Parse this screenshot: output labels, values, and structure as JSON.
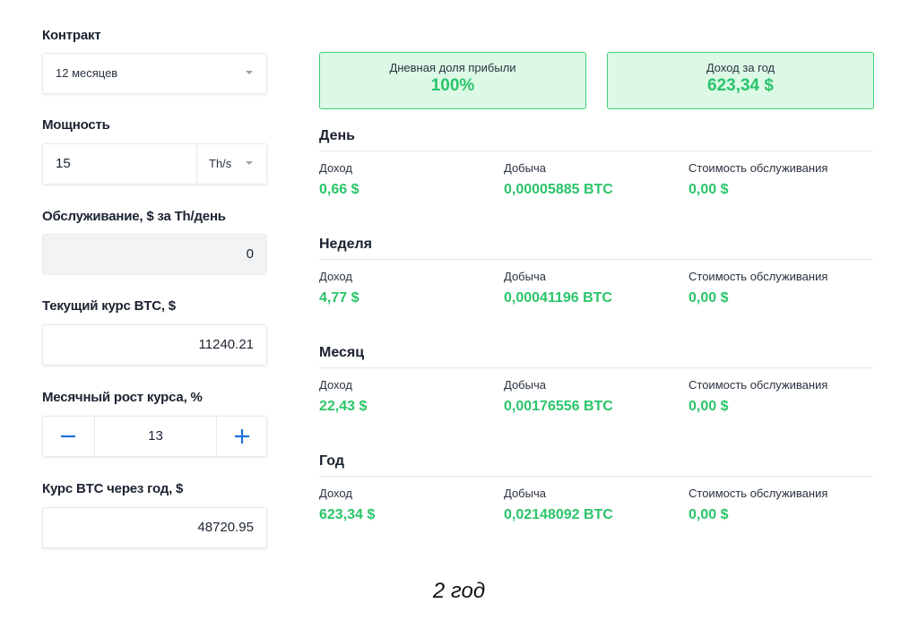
{
  "form": {
    "contract_label": "Контракт",
    "contract_value": "12 месяцев",
    "power_label": "Мощность",
    "power_value": "15",
    "power_unit": "Th/s",
    "maintenance_label": "Обслуживание, $ за Th/день",
    "maintenance_value": "0",
    "btc_rate_label": "Текущий курс BTC, $",
    "btc_rate_value": "11240.21",
    "growth_label": "Месячный рост курса, %",
    "growth_value": "13",
    "btc_year_label": "Курс BTC через год, $",
    "btc_year_value": "48720.95"
  },
  "summary": {
    "daily_share_title": "Дневная доля прибыли",
    "daily_share_value": "100%",
    "yearly_income_title": "Доход за год",
    "yearly_income_value": "623,34 $"
  },
  "columns": {
    "income": "Доход",
    "mined": "Добыча",
    "service_cost": "Стоимость обслуживания"
  },
  "periods": [
    {
      "title": "День",
      "income": "0,66 $",
      "mined": "0,00005885 BTC",
      "service_cost": "0,00 $"
    },
    {
      "title": "Неделя",
      "income": "4,77 $",
      "mined": "0,00041196 BTC",
      "service_cost": "0,00 $"
    },
    {
      "title": "Месяц",
      "income": "22,43 $",
      "mined": "0,00176556 BTC",
      "service_cost": "0,00 $"
    },
    {
      "title": "Год",
      "income": "623,34 $",
      "mined": "0,02148092 BTC",
      "service_cost": "0,00 $"
    }
  ],
  "caption": "2 год",
  "colors": {
    "accent_green": "#2ac46a",
    "card_bg": "#dcf9e6",
    "card_border": "#3fcf76",
    "stepper_blue": "#1e6fd9"
  },
  "icons": {
    "select_caret": "caret-down-icon",
    "minus": "minus-icon",
    "plus": "plus-icon"
  }
}
